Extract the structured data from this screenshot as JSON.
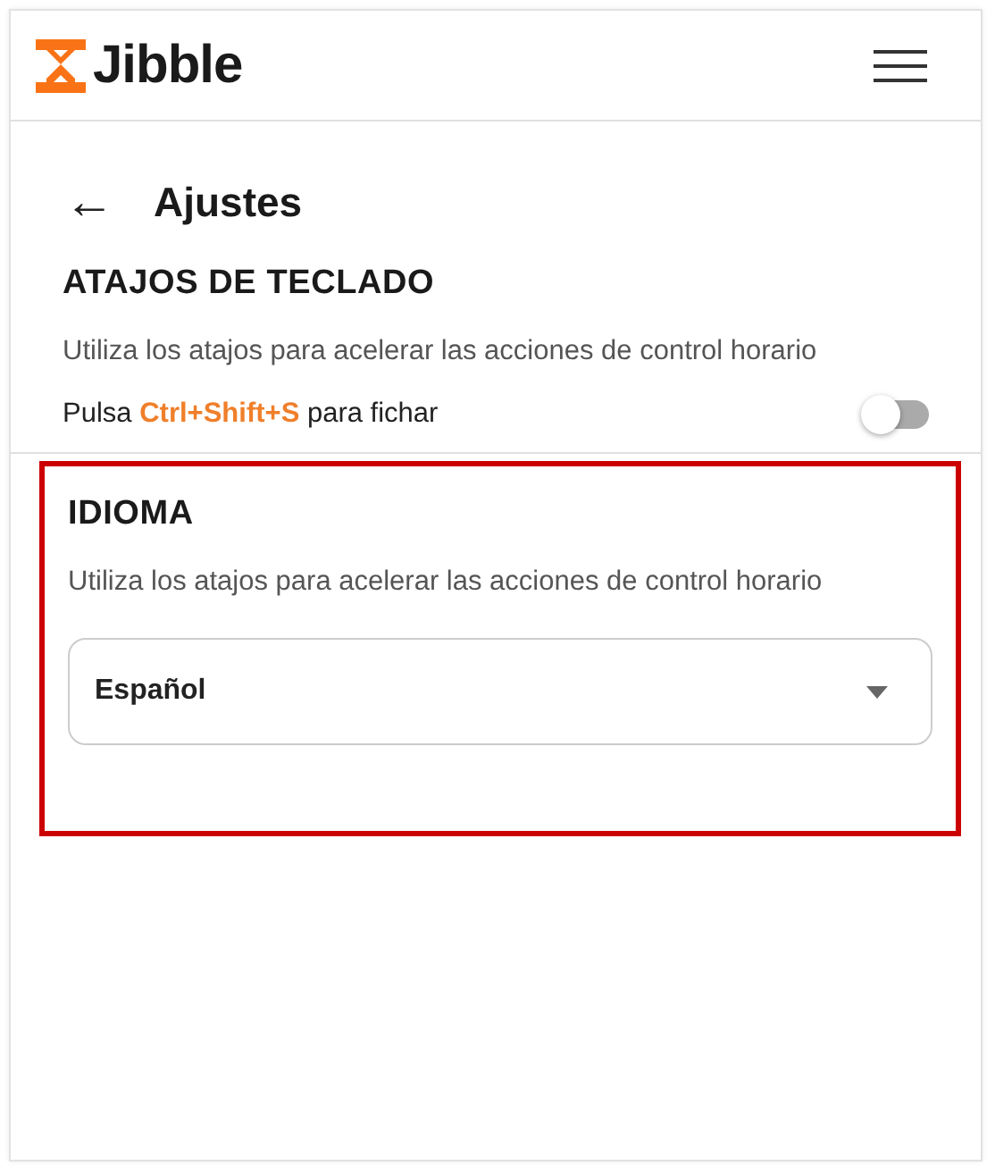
{
  "header": {
    "logo_text": "Jibble"
  },
  "page": {
    "back": "←",
    "title": "Ajustes"
  },
  "sections": [
    {
      "kind": "toggle",
      "heading": "ATAJOS DE TECLADO",
      "description": "Utiliza los atajos para acelerar las acciones de control horario",
      "highlighted": false,
      "setting": {
        "label": "Pulsa **Ctrl+Shift+S** para fichar",
        "on": false
      }
    },
    {
      "kind": "select",
      "heading": "IDIOMA",
      "description": "Utiliza los atajos para acelerar las acciones de control horario",
      "highlighted": true,
      "select": {
        "value": "Español"
      }
    }
  ]
}
